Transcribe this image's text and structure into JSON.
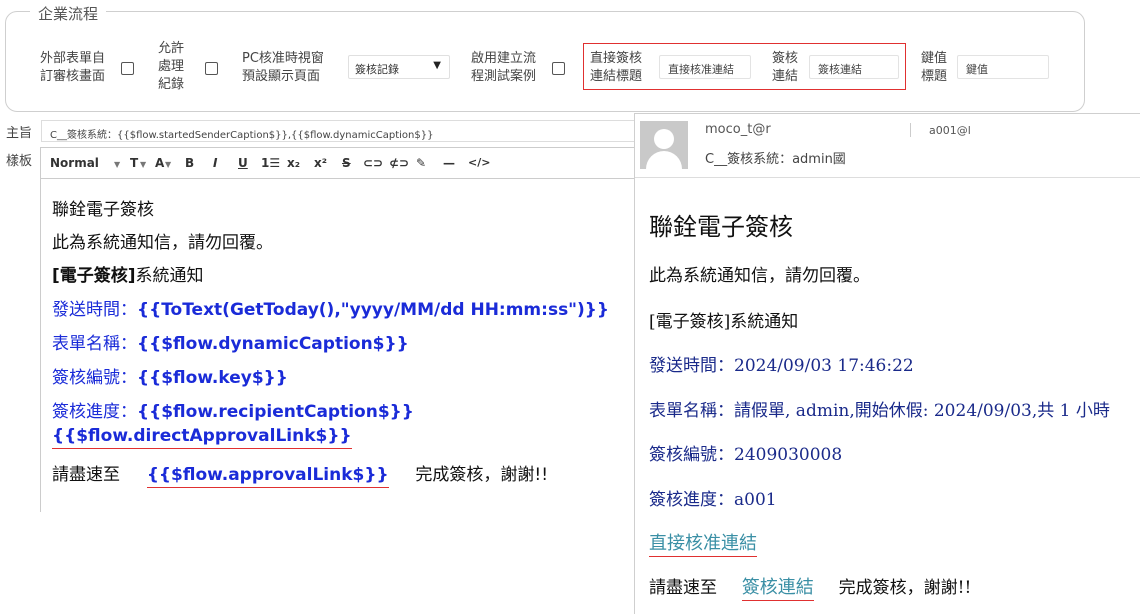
{
  "settings": {
    "legend": "企業流程",
    "custom_review_label_1": "外部表單自",
    "custom_review_label_2": "訂審核畫面",
    "allow_record_label_1": "允許",
    "allow_record_label_2": "處理",
    "allow_record_label_3": "紀錄",
    "pc_view_label_1": "PC核准時視窗",
    "pc_view_label_2": "預設顯示頁面",
    "pc_view_value": "簽核記錄",
    "test_case_label_1": "啟用建立流",
    "test_case_label_2": "程測試案例",
    "direct_link_label_1": "直接簽核",
    "direct_link_label_2": "連結標題",
    "direct_link_value": "直接核准連結",
    "sign_link_label_1": "簽核",
    "sign_link_label_2": "連結",
    "sign_link_value": "簽核連結",
    "key_label_1": "鍵值",
    "key_label_2": "標題",
    "key_value": "鍵值"
  },
  "subject": {
    "label": "主旨",
    "value": "C__簽核系統：{{$flow.startedSenderCaption$}},{{$flow.dynamicCaption$}}"
  },
  "template": {
    "label": "樣板",
    "toolbar": {
      "format": "Normal",
      "text_size": "T",
      "font_color": "A",
      "bold": "B",
      "italic": "I",
      "underline": "U",
      "subscript": "x₂",
      "superscript": "x²",
      "strike": "S"
    },
    "lines": {
      "l1": "聯銓電子簽核",
      "l2": "此為系統通知信，請勿回覆。",
      "l3_bracket": "[電子簽核]",
      "l3_text": "系統通知",
      "l4_label": "發送時間：",
      "l4_expr": "{{ToText(GetToday(),\"yyyy/MM/dd HH:mm:ss\")}}",
      "l5_label": "表單名稱：",
      "l5_expr": "{{$flow.dynamicCaption$}}",
      "l6_label": "簽核編號：",
      "l6_expr": "{{$flow.key$}}",
      "l7_label": "簽核進度：",
      "l7_expr": "{{$flow.recipientCaption$}}",
      "l8_expr": "{{$flow.directApprovalLink$}}",
      "l9_pre": "請盡速至",
      "l9_expr": "{{$flow.approvalLink$}}",
      "l9_post": "完成簽核，謝謝!!"
    }
  },
  "preview": {
    "sender": "moco_t@r",
    "recipient": "a001@l",
    "subject": "C__簽核系統：admin國",
    "title": "聯銓電子簽核",
    "notice": "此為系統通知信，請勿回覆。",
    "system": "[電子簽核]系統通知",
    "send_time": "發送時間：2024/09/03 17:46:22",
    "form_name": "表單名稱：請假單, admin,開始休假: 2024/09/03,共 1 小時",
    "key": "簽核編號：2409030008",
    "progress": "簽核進度：a001",
    "direct_link": "直接核准連結",
    "please_pre": "請盡速至",
    "sign_link": "簽核連結",
    "please_post": "完成簽核，謝謝!!"
  }
}
